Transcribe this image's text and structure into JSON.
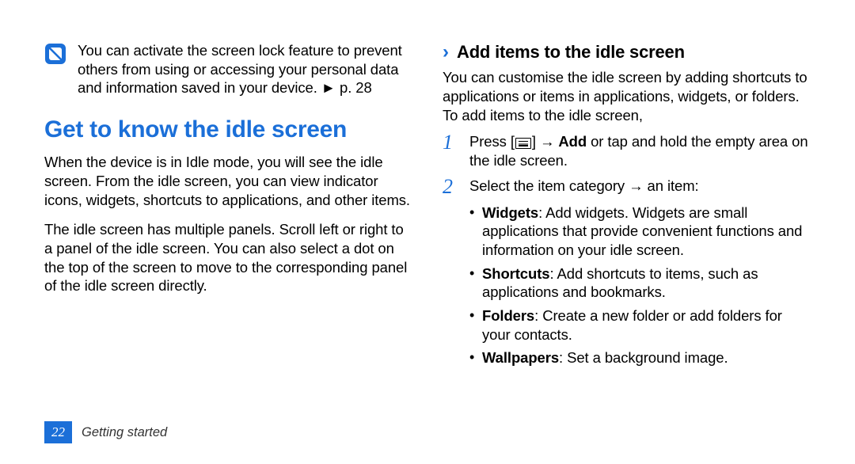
{
  "left": {
    "note": "You can activate the screen lock feature to prevent others from using or accessing your personal data and information saved in your device. ► p. 28",
    "heading": "Get to know the idle screen",
    "para1": "When the device is in Idle mode, you will see the idle screen. From the idle screen, you can view indicator icons, widgets, shortcuts to applications, and other items.",
    "para2": "The idle screen has multiple panels. Scroll left or right to a panel of the idle screen. You can also select a dot on the top of the screen to move to the corresponding panel of the idle screen directly."
  },
  "right": {
    "chevron": "›",
    "subheading": "Add items to the idle screen",
    "intro": "You can customise the idle screen by adding shortcuts to applications or items in applications, widgets, or folders. To add items to the idle screen,",
    "step1_num": "1",
    "step1_pre": "Press [",
    "step1_mid": "] → ",
    "step1_add": "Add",
    "step1_post": " or tap and hold the empty area on the idle screen.",
    "step2_num": "2",
    "step2_text": "Select the item category → an item:",
    "bullets": {
      "b1_label": "Widgets",
      "b1_text": ": Add widgets. Widgets are small applications that provide convenient functions and information on your idle screen.",
      "b2_label": "Shortcuts",
      "b2_text": ": Add shortcuts to items, such as applications and bookmarks.",
      "b3_label": "Folders",
      "b3_text": ": Create a new folder or add folders for your contacts.",
      "b4_label": "Wallpapers",
      "b4_text": ": Set a background image."
    }
  },
  "footer": {
    "page": "22",
    "section": "Getting started"
  }
}
